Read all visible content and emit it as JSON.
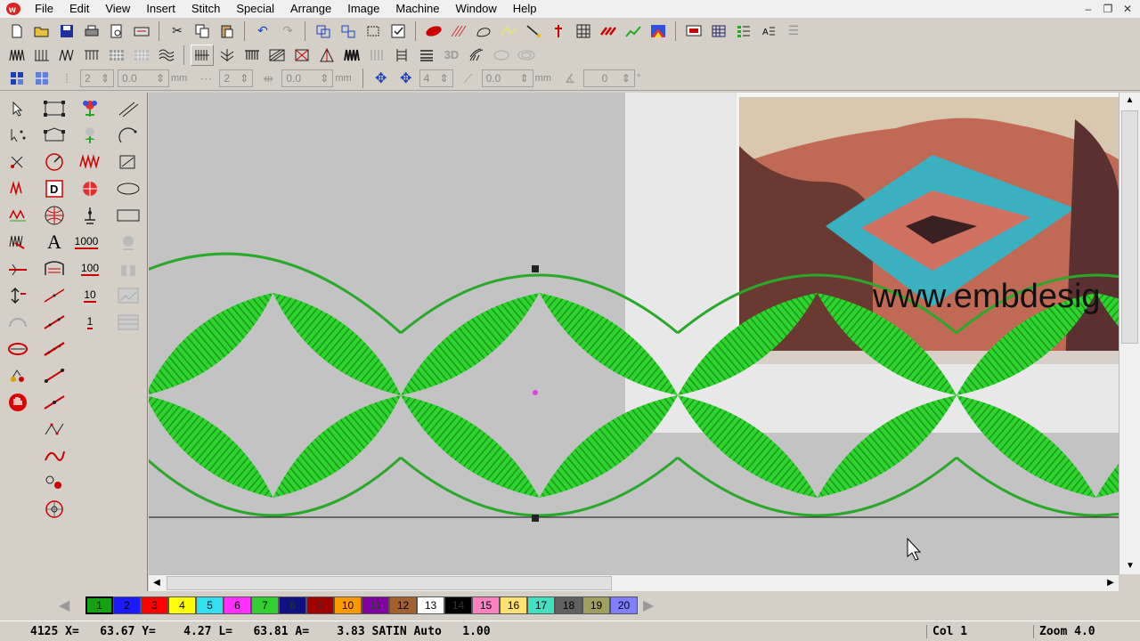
{
  "menu": [
    "File",
    "Edit",
    "View",
    "Insert",
    "Stitch",
    "Special",
    "Arrange",
    "Image",
    "Machine",
    "Window",
    "Help"
  ],
  "window_controls": [
    "–",
    "❐",
    "✕"
  ],
  "toolbar3": {
    "field1": "2",
    "field2": "0.0",
    "unit1": "mm",
    "field3": "2",
    "field4": "0.0",
    "unit2": "mm",
    "field5": "4",
    "field6": "0.0",
    "unit3": "mm",
    "field7": "0",
    "unit4": "°"
  },
  "left_tools": {
    "text_1000": "1000",
    "text_100": "100",
    "text_10": "10",
    "text_1": "1",
    "text_A": "A"
  },
  "canvas": {
    "watermark_text": "www.embdesig",
    "stitch_color": "#2fd42f",
    "background": "#c3c3c3"
  },
  "colors": [
    {
      "n": "1",
      "c": "#16a016"
    },
    {
      "n": "2",
      "c": "#1a1aff"
    },
    {
      "n": "3",
      "c": "#ff0000"
    },
    {
      "n": "4",
      "c": "#ffff00"
    },
    {
      "n": "5",
      "c": "#30e0f0"
    },
    {
      "n": "6",
      "c": "#ff30ff"
    },
    {
      "n": "7",
      "c": "#30d030"
    },
    {
      "n": "8",
      "c": "#101080"
    },
    {
      "n": "9",
      "c": "#a00000"
    },
    {
      "n": "10",
      "c": "#ff9900"
    },
    {
      "n": "11",
      "c": "#8000a0"
    },
    {
      "n": "12",
      "c": "#a06030"
    },
    {
      "n": "13",
      "c": "#ffffff"
    },
    {
      "n": "14",
      "c": "#000000"
    },
    {
      "n": "15",
      "c": "#ff80c0"
    },
    {
      "n": "16",
      "c": "#ffe070"
    },
    {
      "n": "17",
      "c": "#40e0c0"
    },
    {
      "n": "18",
      "c": "#606060"
    },
    {
      "n": "19",
      "c": "#a0a060"
    },
    {
      "n": "20",
      "c": "#8080ff"
    }
  ],
  "status": {
    "main": "4125 X=   63.67 Y=    4.27 L=   63.81 A=    3.83 SATIN Auto   1.00",
    "col": "Col 1",
    "zoom": "Zoom 4.0"
  }
}
